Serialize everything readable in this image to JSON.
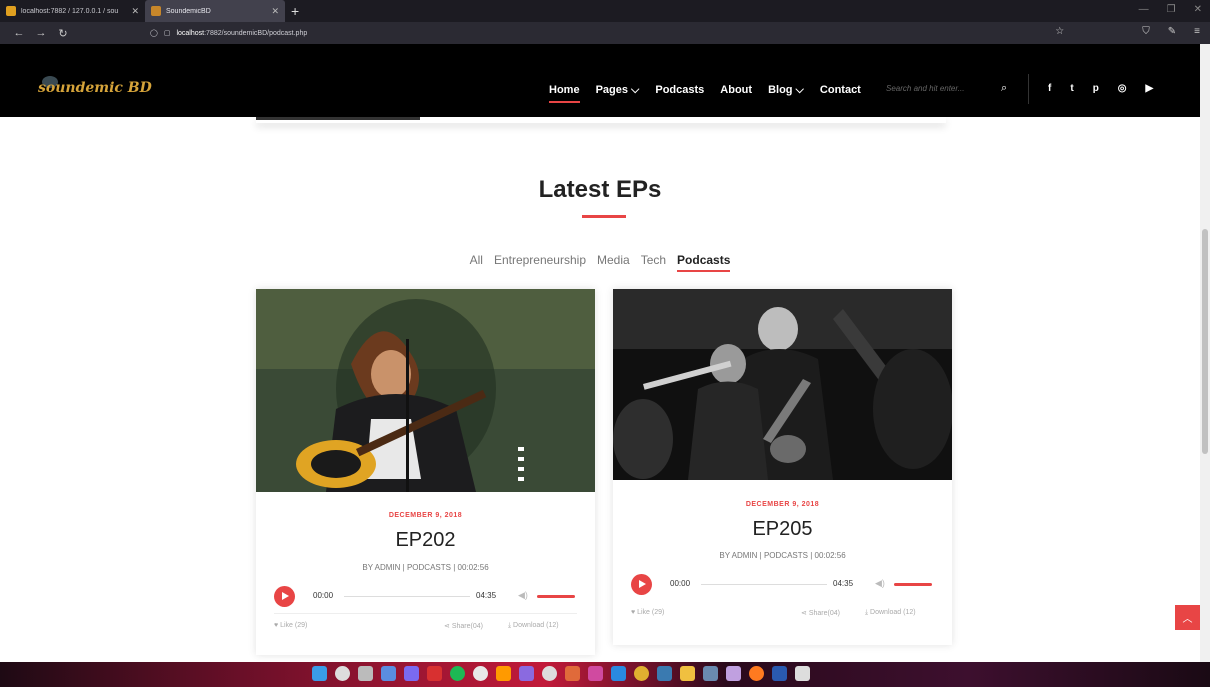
{
  "browser": {
    "tabs": [
      {
        "title": "localhost:7882 / 127.0.0.1 / sou",
        "active": false
      },
      {
        "title": "SoundemicBD",
        "active": true
      }
    ],
    "new_tab": "+",
    "url_host": "localhost",
    "url_rest": ":7882/soundemicBD/podcast.php"
  },
  "site": {
    "logo_text": "soundemic BD",
    "menu": [
      {
        "label": "Home",
        "active": true
      },
      {
        "label": "Pages ⌵",
        "active": false
      },
      {
        "label": "Podcasts",
        "active": false
      },
      {
        "label": "About",
        "active": false
      },
      {
        "label": "Blog ⌵",
        "active": false
      },
      {
        "label": "Contact",
        "active": false
      }
    ],
    "search_placeholder": "Search and hit enter...",
    "social": [
      "f",
      "t",
      "p",
      "◎",
      "▶"
    ]
  },
  "section": {
    "title": "Latest EPs",
    "filters": [
      {
        "label": "All",
        "active": false
      },
      {
        "label": "Entrepreneurship",
        "active": false
      },
      {
        "label": "Media",
        "active": false
      },
      {
        "label": "Tech",
        "active": false
      },
      {
        "label": "Podcasts",
        "active": true
      }
    ]
  },
  "cards": [
    {
      "date": "DECEMBER 9, 2018",
      "title": "EP202",
      "meta": "BY ADMIN | PODCASTS | 00:02:56",
      "time_current": "00:00",
      "time_duration": "04:35",
      "like": "Like (29)",
      "share": "Share(04)",
      "download": "Download (12)"
    },
    {
      "date": "DECEMBER 9, 2018",
      "title": "EP205",
      "meta": "BY ADMIN | PODCASTS | 00:02:56",
      "time_current": "00:00",
      "time_duration": "04:35",
      "like": "Like (29)",
      "share": "Share(04)",
      "download": "Download (12)"
    }
  ],
  "colors": {
    "accent": "#e84545",
    "header_bg": "#000000",
    "logo": "#d6a43a"
  }
}
